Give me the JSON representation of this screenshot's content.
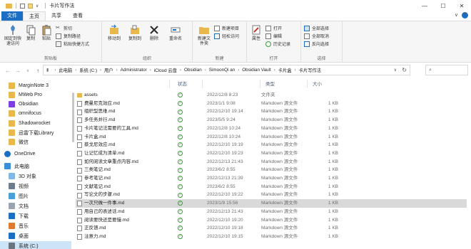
{
  "window": {
    "title": "卡片写作法",
    "controls": [
      "—",
      "☐",
      "✕"
    ]
  },
  "ribbon_tabs": [
    {
      "label": "文件"
    },
    {
      "label": "主页"
    },
    {
      "label": "共享"
    },
    {
      "label": "查看"
    }
  ],
  "ribbon": {
    "clipboard": {
      "label": "剪贴板",
      "pin": "固定到快速访问",
      "copy": "复制",
      "paste": "粘贴",
      "cut": "剪切",
      "copy_path": "复制路径",
      "paste_shortcut": "粘贴快捷方式"
    },
    "organize": {
      "label": "组织",
      "move_to": "移动到",
      "copy_to": "复制到",
      "delete": "删除",
      "rename": "重命名"
    },
    "new": {
      "label": "新建",
      "new_folder": "新建文件夹",
      "new_item": "新建项目",
      "easy_access": "轻松访问"
    },
    "open": {
      "label": "打开",
      "properties": "属性",
      "open": "打开",
      "edit": "编辑",
      "history": "历史记录"
    },
    "select": {
      "label": "选择",
      "select_all": "全部选择",
      "select_none": "全部取消",
      "invert": "反向选择"
    }
  },
  "breadcrumb": [
    "此电脑",
    "系统 (C:)",
    "用户",
    "Administrator",
    "iCloud 云盘",
    "Obsidian",
    "SimoonQi an",
    "Obsidian Vault",
    "卡片盒",
    "卡片写作法"
  ],
  "nav_items": [
    {
      "label": "MarginNote 3"
    },
    {
      "label": "MWeb Pro"
    },
    {
      "label": "Obsidian"
    },
    {
      "label": "omnifocus"
    },
    {
      "label": "Shadowrocket"
    },
    {
      "label": "迅雷下载Library"
    },
    {
      "label": "微信"
    },
    {
      "label": "OneDrive"
    },
    {
      "label": "此电脑"
    },
    {
      "label": "3D 对象"
    },
    {
      "label": "视频"
    },
    {
      "label": "图片"
    },
    {
      "label": "文档"
    },
    {
      "label": "下载"
    },
    {
      "label": "音乐"
    },
    {
      "label": "桌面"
    },
    {
      "label": "系统 (C:)"
    },
    {
      "label": "软件 (D:)"
    }
  ],
  "columns": {
    "status": "状态",
    "date": "",
    "type": "类型",
    "size": "大小"
  },
  "files": [
    {
      "name": "assets",
      "date": "2022/12/8 8:23",
      "type": "文件夹",
      "size": "",
      "folder": true
    },
    {
      "name": "费曼尼克效应.md",
      "date": "2023/1/1 9:08",
      "type": "Markdown 源文件",
      "size": "1 KB"
    },
    {
      "name": "组织型思维.md",
      "date": "2022/12/10 19:14",
      "type": "Markdown 源文件",
      "size": "1 KB"
    },
    {
      "name": "多任务并行.md",
      "date": "2023/5/5 9:24",
      "type": "Markdown 源文件",
      "size": "1 KB"
    },
    {
      "name": "卡片笔记法需要的工具.md",
      "date": "2022/12/8 10:24",
      "type": "Markdown 源文件",
      "size": "1 KB"
    },
    {
      "name": "卡片盒.md",
      "date": "2022/12/8 10:24",
      "type": "Markdown 源文件",
      "size": "1 KB"
    },
    {
      "name": "蔡戈尼效应.md",
      "date": "2022/12/10 19:19",
      "type": "Markdown 源文件",
      "size": "1 KB"
    },
    {
      "name": "让记忆成为清单.md",
      "date": "2022/12/10 19:23",
      "type": "Markdown 源文件",
      "size": "1 KB"
    },
    {
      "name": "如何阅读文章重点内容.md",
      "date": "2022/12/13 21:43",
      "type": "Markdown 源文件",
      "size": "1 KB"
    },
    {
      "name": "三类笔记.md",
      "date": "2023/6/2 8:55",
      "type": "Markdown 源文件",
      "size": "1 KB"
    },
    {
      "name": "参考笔记.md",
      "date": "2022/12/13 21:39",
      "type": "Markdown 源文件",
      "size": "1 KB"
    },
    {
      "name": "文献笔记.md",
      "date": "2023/6/2 8:55",
      "type": "Markdown 源文件",
      "size": "1 KB"
    },
    {
      "name": "写论文的步骤.md",
      "date": "2022/12/10 19:22",
      "type": "Markdown 源文件",
      "size": "1 KB"
    },
    {
      "name": "一次只做一件事.md",
      "date": "2023/1/9 15:56",
      "type": "Markdown 源文件",
      "size": "1 KB",
      "selected": true
    },
    {
      "name": "用自己的表述话.md",
      "date": "2022/12/13 21:43",
      "type": "Markdown 源文件",
      "size": "1 KB"
    },
    {
      "name": "阅读要快还是要慢.md",
      "date": "2022/12/10 19:20",
      "type": "Markdown 源文件",
      "size": "1 KB"
    },
    {
      "name": "正反馈.md",
      "date": "2022/12/10 19:18",
      "type": "Markdown 源文件",
      "size": "1 KB"
    },
    {
      "name": "注意力.md",
      "date": "2022/12/10 19:15",
      "type": "Markdown 源文件",
      "size": "1 KB"
    }
  ],
  "colors": {
    "accent": "#1a6fc4",
    "folder": "#e8b84a",
    "sync_ok": "#3a9a3a"
  }
}
